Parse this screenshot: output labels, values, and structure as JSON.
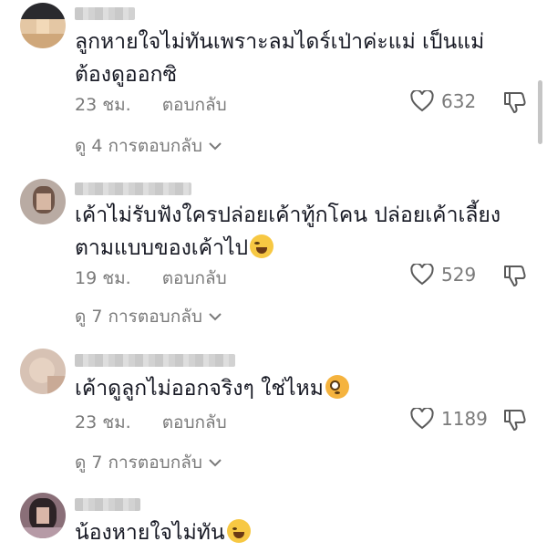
{
  "comments": [
    {
      "text": "ลูกหายใจไม่ทันเพราะลมไดร์เป่าค่ะแม่ เป็นแม่ต้องดูออกซิ",
      "time": "23 ชม.",
      "reply_label": "ตอบกลับ",
      "likes": "632",
      "view_replies": "ดู 4 การตอบกลับ",
      "emoji": ""
    },
    {
      "text": "เค้าไม่รับฟังใครปล่อยเค้าทู้กโคน ปล่อยเค้าเลี้ยงตามแบบของเค้าไป",
      "time": "19 ชม.",
      "reply_label": "ตอบกลับ",
      "likes": "529",
      "view_replies": "ดู 7 การตอบกลับ",
      "emoji": "laughing-crying-emoji"
    },
    {
      "text": "เค้าดูลูกไม่ออกจริงๆ ใช่ไหม",
      "time": "23 ชม.",
      "reply_label": "ตอบกลับ",
      "likes": "1189",
      "view_replies": "ดู 7 การตอบกลับ",
      "emoji": "flushed-emoji"
    },
    {
      "text": "น้องหายใจไม่ทัน",
      "emoji": "sweat-smile-emoji"
    }
  ],
  "icons": {
    "like": "heart-outline-icon",
    "dislike": "thumbs-down-icon",
    "expand": "chevron-down-icon"
  },
  "colors": {
    "text": "#161823",
    "muted": "#7a7a7a",
    "background": "#ffffff"
  }
}
